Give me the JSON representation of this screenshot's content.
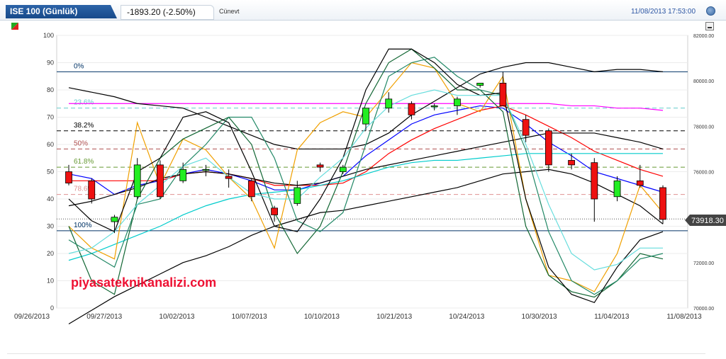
{
  "header": {
    "title": "ISE 100 (Günlük)",
    "price_change": "-1893.20 (-2.50%)",
    "update_label": "Cünevt",
    "datetime": "11/08/2013 17:53:00"
  },
  "icons": {
    "corner": "color-swatch-icon",
    "refresh": "refresh-icon",
    "minimize": "minimize-icon"
  },
  "colors": {
    "up_candle": "#22ee22",
    "down_candle": "#ee1111",
    "price_tag": "#444444"
  },
  "chart_data": {
    "type": "candlestick",
    "watermark": "piyasateknikanalizi.com",
    "x_labels": [
      "09/26/2013",
      "09/27/2013",
      "10/02/2013",
      "10/07/2013",
      "10/10/2013",
      "10/21/2013",
      "10/24/2013",
      "10/30/2013",
      "11/04/2013",
      "11/08/2013"
    ],
    "left_axis": {
      "min": 0,
      "max": 100,
      "ticks": [
        0,
        10,
        20,
        30,
        40,
        50,
        60,
        70,
        80,
        90,
        100
      ]
    },
    "right_axis": {
      "min": 70000,
      "max": 82000,
      "ticks": [
        "70000.00",
        "72000.00",
        "74000.00",
        "76000.00",
        "78000.00",
        "80000.00",
        "82000.00"
      ]
    },
    "last_price": "73918.30",
    "fibonacci": [
      {
        "label": "0%",
        "value": 80400,
        "color": "#003366"
      },
      {
        "label": "23.6%",
        "value": 78800,
        "color": "#66cccc"
      },
      {
        "label": "38.2%",
        "value": 77800,
        "color": "#000000"
      },
      {
        "label": "50%",
        "value": 77000,
        "color": "#b05050"
      },
      {
        "label": "61.8%",
        "value": 76200,
        "color": "#669933"
      },
      {
        "label": "78.6%",
        "value": 75000,
        "color": "#e09090"
      },
      {
        "label": "100%",
        "value": 73400,
        "color": "#003366"
      }
    ],
    "candles": [
      {
        "o": 76000,
        "h": 76300,
        "l": 75400,
        "c": 75500
      },
      {
        "o": 75600,
        "h": 75700,
        "l": 74600,
        "c": 74800
      },
      {
        "o": 73800,
        "h": 74100,
        "l": 73300,
        "c": 74000
      },
      {
        "o": 74900,
        "h": 76600,
        "l": 74800,
        "c": 76300
      },
      {
        "o": 76300,
        "h": 76500,
        "l": 74800,
        "c": 74900
      },
      {
        "o": 75600,
        "h": 76400,
        "l": 75500,
        "c": 76100
      },
      {
        "o": 76100,
        "h": 76300,
        "l": 75800,
        "c": 76100
      },
      {
        "o": 75800,
        "h": 76100,
        "l": 75300,
        "c": 75700
      },
      {
        "o": 75600,
        "h": 75700,
        "l": 74700,
        "c": 74900
      },
      {
        "o": 74400,
        "h": 74500,
        "l": 73800,
        "c": 74100
      },
      {
        "o": 74600,
        "h": 75600,
        "l": 74500,
        "c": 75300
      },
      {
        "o": 76300,
        "h": 76400,
        "l": 76000,
        "c": 76200
      },
      {
        "o": 76000,
        "h": 76300,
        "l": 75900,
        "c": 76200
      },
      {
        "o": 78100,
        "h": 78400,
        "l": 77800,
        "c": 78800
      },
      {
        "o": 78800,
        "h": 79500,
        "l": 78600,
        "c": 79200
      },
      {
        "o": 79000,
        "h": 79100,
        "l": 78300,
        "c": 78500
      },
      {
        "o": 78900,
        "h": 79000,
        "l": 78700,
        "c": 78900
      },
      {
        "o": 78900,
        "h": 79300,
        "l": 78500,
        "c": 79200
      },
      {
        "o": 79800,
        "h": 79900,
        "l": 79700,
        "c": 79900
      },
      {
        "o": 79900,
        "h": 80400,
        "l": 78900,
        "c": 78900
      },
      {
        "o": 78300,
        "h": 78500,
        "l": 77300,
        "c": 77600
      },
      {
        "o": 77800,
        "h": 77900,
        "l": 76000,
        "c": 76300
      },
      {
        "o": 76500,
        "h": 76800,
        "l": 76100,
        "c": 76300
      },
      {
        "o": 76400,
        "h": 76600,
        "l": 73800,
        "c": 74800
      },
      {
        "o": 74900,
        "h": 75800,
        "l": 74700,
        "c": 75600
      },
      {
        "o": 75600,
        "h": 76300,
        "l": 75300,
        "c": 75400
      },
      {
        "o": 75300,
        "h": 75400,
        "l": 73700,
        "c": 73900
      }
    ],
    "series": [
      {
        "color": "#0000ff",
        "axis": "price",
        "values": [
          75900,
          75700,
          75000,
          75400,
          75600,
          75900,
          76100,
          75900,
          75600,
          75200,
          75200,
          75500,
          75800,
          76700,
          77400,
          78100,
          78500,
          78700,
          78900,
          78800,
          78100,
          77300,
          76700,
          76000,
          75700,
          75400,
          75100
        ]
      },
      {
        "color": "#ff0000",
        "axis": "price",
        "values": [
          75600,
          75600,
          75600,
          75600,
          75600,
          75900,
          76000,
          75900,
          75700,
          75400,
          75400,
          75400,
          75500,
          76000,
          76800,
          77400,
          77900,
          78300,
          78700,
          78900,
          78500,
          78000,
          77500,
          76900,
          76500,
          76100,
          75800
        ]
      },
      {
        "color": "#00cccc",
        "axis": "price",
        "values": [
          72100,
          72400,
          72800,
          73200,
          73600,
          74100,
          74500,
          74800,
          75000,
          75100,
          75200,
          75400,
          75600,
          75900,
          76200,
          76400,
          76500,
          76500,
          76600,
          76700,
          76800,
          76800,
          76800,
          76800,
          76800,
          76800,
          76800
        ]
      },
      {
        "color": "#ff00ff",
        "axis": "price",
        "values": [
          79000,
          79000,
          79000,
          79000,
          79000,
          79000,
          79000,
          79000,
          79000,
          79000,
          79000,
          79000,
          79000,
          79000,
          79000,
          79000,
          79000,
          79000,
          79000,
          79000,
          79000,
          79000,
          78900,
          78900,
          78800,
          78800,
          78700
        ]
      },
      {
        "color": "#000000",
        "axis": "price",
        "values": [
          79700,
          79500,
          79300,
          79000,
          78900,
          78800,
          78400,
          78000,
          77600,
          77200,
          77000,
          77000,
          77000,
          77200,
          77700,
          78500,
          79100,
          79700,
          80300,
          80600,
          80800,
          80800,
          80600,
          80400,
          80500,
          80500,
          80400
        ]
      },
      {
        "color": "#000000",
        "axis": "price",
        "values": [
          74500,
          74700,
          75000,
          75300,
          75700,
          75900,
          76000,
          75900,
          75700,
          75500,
          75400,
          75500,
          75800,
          76100,
          76300,
          76500,
          76700,
          76900,
          77100,
          77300,
          77500,
          77700,
          77700,
          77700,
          77500,
          77300,
          77000
        ]
      },
      {
        "color": "#000000",
        "axis": "price",
        "values": [
          69300,
          69900,
          70500,
          71000,
          71500,
          72000,
          72300,
          72700,
          73200,
          73600,
          73900,
          74200,
          74300,
          74500,
          74700,
          74900,
          75100,
          75300,
          75600,
          75900,
          76000,
          76100,
          75900,
          75500,
          75000,
          74500,
          73700
        ]
      },
      {
        "color": "#f0a000",
        "axis": "osc",
        "values": [
          30,
          22,
          18,
          68,
          45,
          62,
          58,
          48,
          40,
          22,
          58,
          68,
          72,
          70,
          80,
          90,
          88,
          75,
          72,
          85,
          40,
          12,
          10,
          6,
          20,
          45,
          35
        ]
      },
      {
        "color": "#116633",
        "axis": "osc",
        "values": [
          30,
          10,
          5,
          40,
          55,
          62,
          66,
          70,
          60,
          35,
          20,
          30,
          50,
          75,
          90,
          95,
          88,
          80,
          80,
          72,
          30,
          12,
          6,
          4,
          10,
          20,
          18
        ]
      },
      {
        "color": "#228866",
        "axis": "osc",
        "values": [
          25,
          20,
          15,
          38,
          40,
          52,
          60,
          70,
          70,
          55,
          32,
          28,
          35,
          60,
          85,
          90,
          92,
          85,
          80,
          78,
          58,
          28,
          10,
          5,
          10,
          18,
          20
        ]
      },
      {
        "color": "#000000",
        "axis": "osc",
        "values": [
          40,
          32,
          28,
          50,
          55,
          70,
          72,
          68,
          50,
          30,
          28,
          40,
          55,
          80,
          95,
          95,
          90,
          82,
          78,
          79,
          40,
          15,
          5,
          2,
          15,
          25,
          28
        ]
      },
      {
        "color": "#66dddd",
        "axis": "osc",
        "values": [
          20,
          22,
          28,
          38,
          45,
          52,
          55,
          48,
          42,
          40,
          40,
          48,
          55,
          66,
          74,
          78,
          80,
          78,
          78,
          78,
          60,
          38,
          20,
          14,
          16,
          22,
          22
        ]
      }
    ]
  }
}
